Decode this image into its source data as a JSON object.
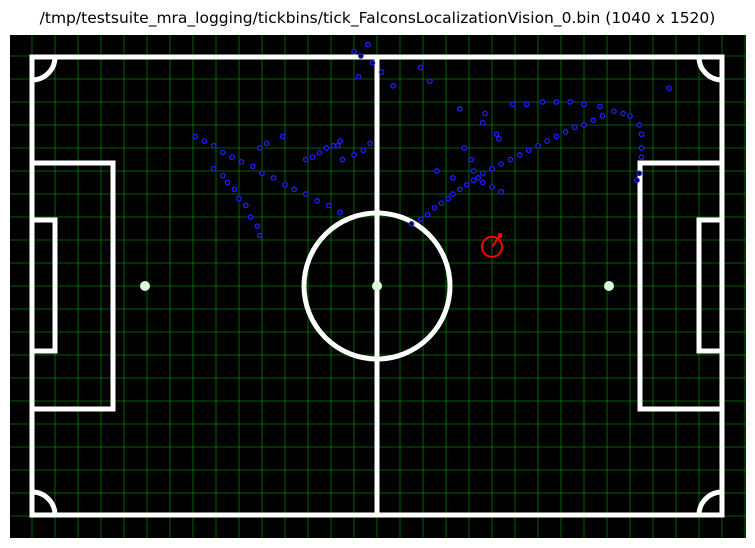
{
  "window": {
    "title": "/tmp/testsuite_mra_logging/tickbins/tick_FalconsLocalizationVision_0.bin (1040 x 1520)"
  },
  "colors": {
    "background": "#000000",
    "field_lines": "#ffffff",
    "grid": "#00b000",
    "detections": "#1e1eff",
    "robot": "#ff0000",
    "penalty_spot": "#d8ffd8"
  },
  "chart_data": {
    "type": "scatter",
    "grid": true,
    "x_range": [
      0,
      1520
    ],
    "y_range": [
      0,
      1040
    ],
    "detections": [
      [
        5.9,
        7.9
      ],
      [
        6.5,
        7.9
      ],
      [
        7.2,
        8.0
      ],
      [
        7.8,
        8.0
      ],
      [
        8.4,
        8.0
      ],
      [
        9.0,
        7.9
      ],
      [
        9.7,
        7.8
      ],
      [
        10.3,
        7.6
      ],
      [
        10.7,
        7.5
      ],
      [
        11.0,
        7.4
      ],
      [
        11.4,
        7.0
      ],
      [
        11.5,
        6.6
      ],
      [
        11.5,
        6.0
      ],
      [
        11.5,
        5.6
      ],
      [
        11.4,
        4.9
      ],
      [
        11.3,
        4.6
      ],
      [
        12.7,
        8.6
      ],
      [
        4.6,
        7.1
      ],
      [
        4.7,
        7.5
      ],
      [
        3.8,
        6.0
      ],
      [
        4.1,
        5.5
      ],
      [
        4.4,
        4.7
      ],
      [
        4.6,
        4.9
      ],
      [
        5.0,
        5.1
      ],
      [
        5.4,
        5.3
      ],
      [
        5.8,
        5.5
      ],
      [
        6.2,
        5.7
      ],
      [
        6.6,
        5.9
      ],
      [
        7.0,
        6.1
      ],
      [
        7.4,
        6.3
      ],
      [
        7.8,
        6.5
      ],
      [
        8.2,
        6.7
      ],
      [
        8.6,
        6.9
      ],
      [
        9.0,
        7.0
      ],
      [
        9.4,
        7.2
      ],
      [
        9.8,
        7.4
      ],
      [
        4.2,
        4.6
      ],
      [
        3.9,
        4.4
      ],
      [
        3.6,
        4.2
      ],
      [
        3.3,
        4.0
      ],
      [
        3.1,
        3.8
      ],
      [
        2.8,
        3.6
      ],
      [
        2.5,
        3.4
      ],
      [
        2.2,
        3.1
      ],
      [
        1.9,
        2.9
      ],
      [
        1.5,
        2.7
      ],
      [
        -1.6,
        3.2
      ],
      [
        -2.1,
        3.5
      ],
      [
        -2.6,
        3.7
      ],
      [
        -3.1,
        4.0
      ],
      [
        -3.6,
        4.2
      ],
      [
        -4.0,
        4.4
      ],
      [
        -4.5,
        4.7
      ],
      [
        -5.0,
        4.9
      ],
      [
        -5.4,
        5.2
      ],
      [
        -5.9,
        5.4
      ],
      [
        -6.3,
        5.6
      ],
      [
        -6.7,
        5.8
      ],
      [
        -7.1,
        6.1
      ],
      [
        -7.5,
        6.3
      ],
      [
        -7.9,
        6.5
      ],
      [
        -1.5,
        5.5
      ],
      [
        -1.7,
        6.1
      ],
      [
        -1.0,
        5.7
      ],
      [
        -0.6,
        5.9
      ],
      [
        -0.3,
        6.2
      ],
      [
        4.2,
        5.0
      ],
      [
        4.6,
        4.5
      ],
      [
        5.0,
        4.3
      ],
      [
        5.4,
        4.1
      ],
      [
        -5.1,
        2.2
      ],
      [
        -5.2,
        2.6
      ],
      [
        -5.5,
        3.0
      ],
      [
        -5.7,
        3.5
      ],
      [
        -6.0,
        3.8
      ],
      [
        -6.2,
        4.2
      ],
      [
        -6.5,
        4.5
      ],
      [
        -6.7,
        4.8
      ],
      [
        -7.1,
        5.1
      ],
      [
        -3.1,
        5.5
      ],
      [
        -2.8,
        5.6
      ],
      [
        -2.5,
        5.8
      ],
      [
        -2.2,
        6.0
      ],
      [
        -1.9,
        6.1
      ],
      [
        -1.6,
        6.3
      ],
      [
        -4.8,
        6.2
      ],
      [
        -5.1,
        6.0
      ],
      [
        -4.1,
        6.5
      ],
      [
        -1.0,
        10.2
      ],
      [
        -0.7,
        10.0
      ],
      [
        -0.4,
        10.5
      ],
      [
        -0.2,
        9.7
      ],
      [
        0.2,
        9.3
      ],
      [
        -0.8,
        9.1
      ],
      [
        5.2,
        6.6
      ],
      [
        5.3,
        6.4
      ],
      [
        0.7,
        8.7
      ],
      [
        1.9,
        9.5
      ],
      [
        2.3,
        8.9
      ],
      [
        3.6,
        7.7
      ],
      [
        2.6,
        5.0
      ],
      [
        3.3,
        4.7
      ]
    ],
    "robot": {
      "x": 5.0,
      "y": 1.7,
      "heading_deg": 55
    }
  }
}
